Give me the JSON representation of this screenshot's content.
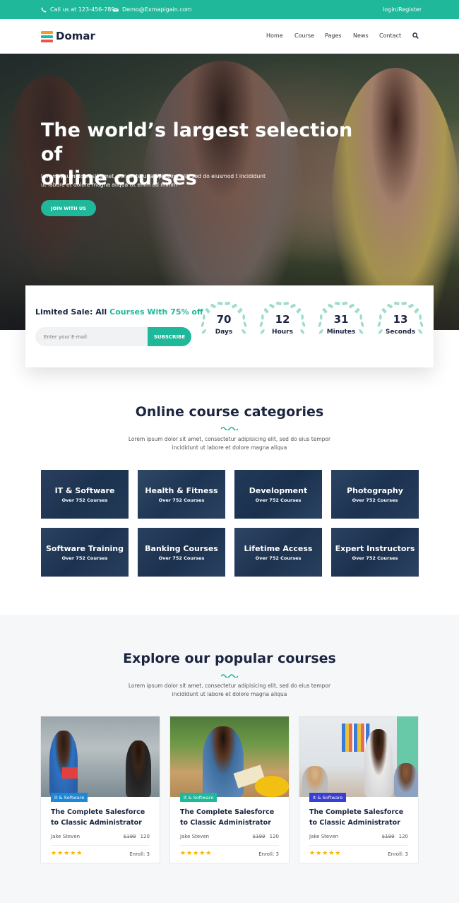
{
  "topbar": {
    "phone": "Call us at 123-456-789",
    "email": "Demo@Exmapigain.com",
    "login": "login/Register"
  },
  "brand": {
    "name": "Domar",
    "accent": "#1fb89a",
    "dark": "#1c2540"
  },
  "nav": {
    "items": [
      "Home",
      "Course",
      "Pages",
      "News",
      "Contact"
    ]
  },
  "hero": {
    "title_line1": "The world’s largest selection of",
    "title_line2": "online courses",
    "desc_line1": "Lorem ipsum dolor sit amet, consectetur adipisicing elit, sed do eiusmod t incididunt",
    "desc_line2": "ut labore et dolore magna aliqua Ut enim ad minim",
    "cta": "JOIN WITH US"
  },
  "sale": {
    "title_prefix": "Limited Sale: All ",
    "title_accent": "Courses With 75% off",
    "email_placeholder": "Enter your E-mail",
    "subscribe": "SUBSCRIBE",
    "countdown": [
      {
        "value": "70",
        "unit": "Days"
      },
      {
        "value": "12",
        "unit": "Hours"
      },
      {
        "value": "31",
        "unit": "Minutes"
      },
      {
        "value": "13",
        "unit": "Seconds"
      }
    ]
  },
  "categories": {
    "title": "Online course categories",
    "desc_line1": "Lorem ipsum dolor sit amet, consectetur adipisicing elit, sed do eius tempor",
    "desc_line2": "incididunt ut labore et dolore magna aliqua",
    "items": [
      {
        "title": "IT & Software",
        "count": "Over 752 Courses"
      },
      {
        "title": "Health & Fitness",
        "count": "Over 752 Courses"
      },
      {
        "title": "Development",
        "count": "Over 752 Courses"
      },
      {
        "title": "Photography",
        "count": "Over 752 Courses"
      },
      {
        "title": "Software Training",
        "count": "Over 752 Courses"
      },
      {
        "title": "Banking Courses",
        "count": "Over 752 Courses"
      },
      {
        "title": "Lifetime Access",
        "count": "Over 752 Courses"
      },
      {
        "title": "Expert Instructors",
        "count": "Over 752 Courses"
      }
    ]
  },
  "popular": {
    "title": "Explore our popular courses",
    "desc_line1": "Lorem ipsum dolor sit amet, consectetur adipisicing elit, sed do eius tempor",
    "desc_line2": "incididunt ut labore et dolore magna aliqua",
    "courses": [
      {
        "tag": "It & Software",
        "tag_color": "#1e88d8",
        "title_line1": "The Complete Salesforce",
        "title_line2": "to Classic Administrator",
        "author": "Jake Steven",
        "old_price": "$199",
        "price": "120",
        "rating": "★★★★★",
        "enroll": "Enroll: 3"
      },
      {
        "tag": "It & Software",
        "tag_color": "#1fb89a",
        "title_line1": "The Complete Salesforce",
        "title_line2": "to Classic Administrator",
        "author": "Jake Steven",
        "old_price": "$199",
        "price": "120",
        "rating": "★★★★★",
        "enroll": "Enroll: 3"
      },
      {
        "tag": "It & Software",
        "tag_color": "#3a3fd4",
        "title_line1": "The Complete Salesforce",
        "title_line2": "to Classic Administrator",
        "author": "Jake Steven",
        "old_price": "$199",
        "price": "120",
        "rating": "★★★★★",
        "enroll": "Enroll: 3"
      }
    ]
  }
}
